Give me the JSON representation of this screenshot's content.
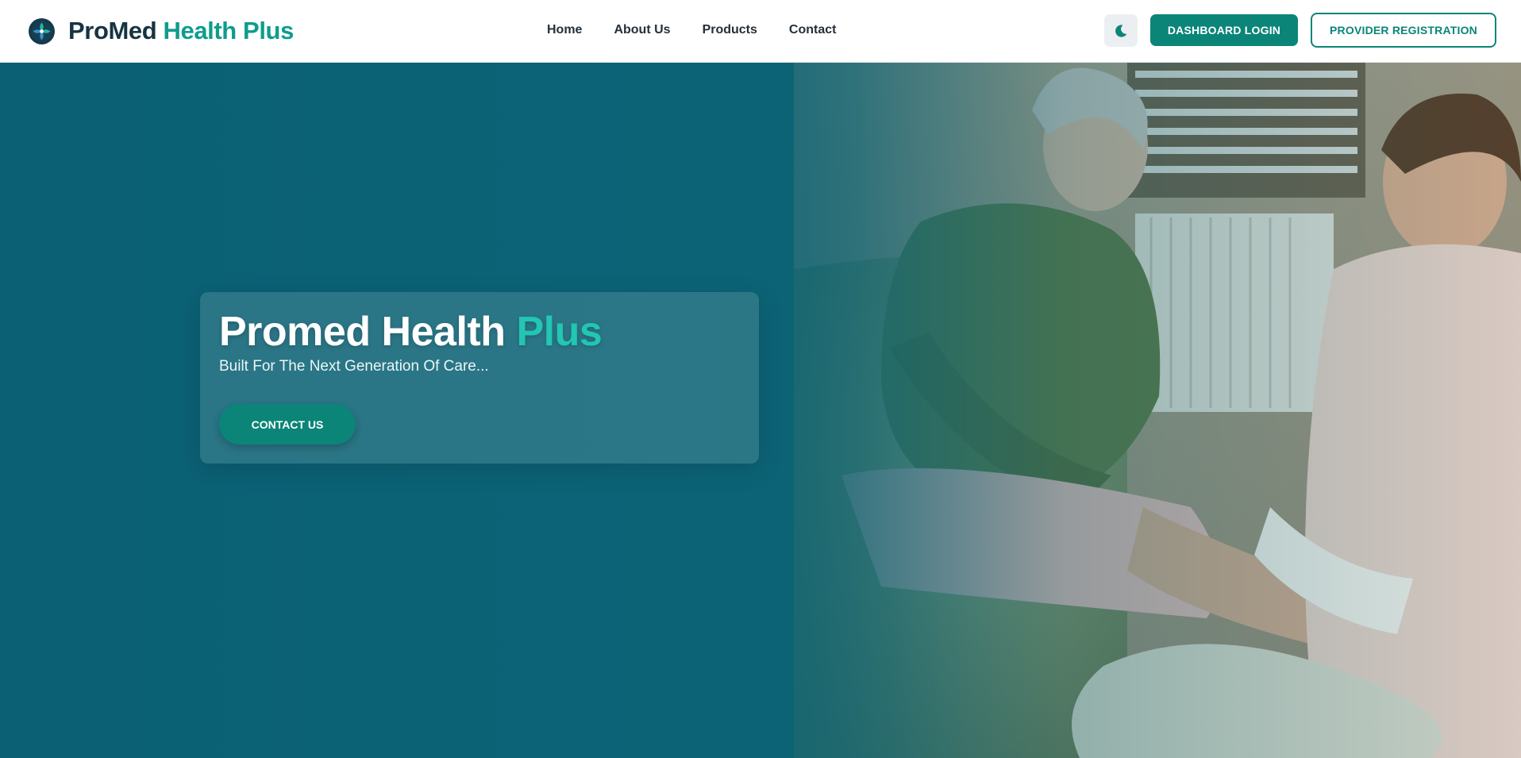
{
  "header": {
    "brand": {
      "name_part1": "ProMed",
      "name_part2": "Health Plus"
    },
    "nav": [
      {
        "label": "Home"
      },
      {
        "label": "About Us"
      },
      {
        "label": "Products"
      },
      {
        "label": "Contact"
      }
    ],
    "theme_toggle_icon": "moon-icon",
    "dashboard_login_label": "DASHBOARD LOGIN",
    "provider_registration_label": "PROVIDER REGISTRATION"
  },
  "hero": {
    "title_part1": "Promed Health",
    "title_part2": "Plus",
    "subtitle": "Built For The Next Generation Of Care...",
    "cta_label": "CONTACT US"
  },
  "colors": {
    "brand_teal": "#0b8578",
    "accent_teal": "#22c6b3",
    "hero_overlay": "#0c6072",
    "text_dark": "#163442"
  }
}
